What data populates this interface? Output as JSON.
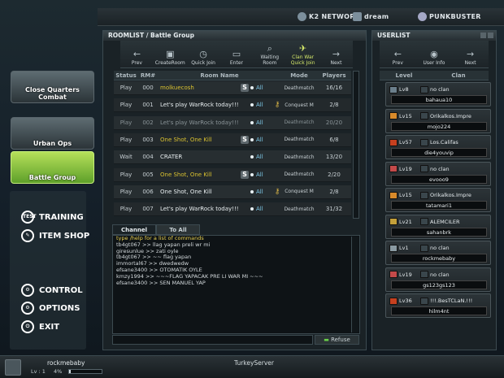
{
  "brand": {
    "left": "K2 NETWORK",
    "mid": "dream",
    "right": "PUNKBUSTER"
  },
  "roomlist": {
    "title": "ROOMLIST / Battle Group",
    "toolbar": [
      {
        "label": "Prev",
        "icon": "←"
      },
      {
        "label": "CreateRoom",
        "icon": "▣"
      },
      {
        "label": "Quick Join",
        "icon": "◷"
      },
      {
        "label": "Enter",
        "icon": "▭"
      },
      {
        "label": "Waiting Room",
        "icon": "⌕"
      },
      {
        "label": "Clan War Quick Join",
        "icon": "✈"
      },
      {
        "label": "Next",
        "icon": "→"
      }
    ],
    "headers": [
      "Status",
      "RM#",
      "Room Name",
      "Mode",
      "Players"
    ],
    "rows": [
      {
        "status": "Play",
        "rm": "000",
        "name": "molkuecosh",
        "s": true,
        "key": false,
        "mode": "Deathmatch",
        "players": "16/16",
        "color": "#d8c030"
      },
      {
        "status": "Play",
        "rm": "001",
        "name": "Let's play WarRock today!!!",
        "s": false,
        "key": true,
        "mode": "Conquest M",
        "players": "2/8",
        "color": "#e8eef0"
      },
      {
        "status": "Play",
        "rm": "002",
        "name": "Let's play WarRock today!!!",
        "s": false,
        "key": false,
        "mode": "Deathmatch",
        "players": "20/20",
        "color": "#8a9498"
      },
      {
        "status": "Play",
        "rm": "003",
        "name": "One Shot, One Kill",
        "s": true,
        "key": false,
        "mode": "Deathmatch",
        "players": "6/8",
        "color": "#d8c030"
      },
      {
        "status": "Wait",
        "rm": "004",
        "name": "CRATER",
        "s": false,
        "key": false,
        "mode": "Deathmatch",
        "players": "13/20",
        "color": "#e8eef0"
      },
      {
        "status": "Play",
        "rm": "005",
        "name": "One Shot, One Kill",
        "s": true,
        "key": false,
        "mode": "Deathmatch",
        "players": "2/20",
        "color": "#d8c030"
      },
      {
        "status": "Play",
        "rm": "006",
        "name": "One Shot, One Kill",
        "s": false,
        "key": true,
        "mode": "Conquest M",
        "players": "2/8",
        "color": "#e8eef0"
      },
      {
        "status": "Play",
        "rm": "007",
        "name": "Let's play WarRock today!!!",
        "s": false,
        "key": false,
        "mode": "Deathmatch",
        "players": "31/32",
        "color": "#e8eef0"
      }
    ],
    "all_label": "All"
  },
  "chat": {
    "tabs": [
      "Channel",
      "To All"
    ],
    "lines": [
      "type /help for a list of commands",
      "tb4gt067  >>  llag yapan preli wr mi",
      "giresunlue  >>  zati oyle",
      "tb4gt067  >>  ~~ flag yapan",
      "immortal67  >>  dwedwedw",
      "efsane3400  >>  OTOMATIK OYLE",
      "kmzy1994  >>  ~~~FLAG YAPACAK PRE LI WAR MI ~~~",
      "efsane3400  >>  SEN MANUEL YAP"
    ],
    "refuse_label": "Refuse"
  },
  "userlist": {
    "title": "USERLIST",
    "toolbar": [
      {
        "label": "Prev",
        "icon": "←"
      },
      {
        "label": "User Info",
        "icon": "◉"
      },
      {
        "label": "Next",
        "icon": "→"
      }
    ],
    "headers": [
      "Level",
      "Clan"
    ],
    "users": [
      {
        "level": "Lv8",
        "clan": "no clan",
        "nick": "bahaua10",
        "rank_color": "#6b7f8c"
      },
      {
        "level": "Lv15",
        "clan": "Orikalkos.Impre",
        "nick": "mojo224",
        "rank_color": "#d88a2a"
      },
      {
        "level": "Lv57",
        "clan": "Los.Califas",
        "nick": "die4youvip",
        "rank_color": "#c6401f"
      },
      {
        "level": "Lv19",
        "clan": "no clan",
        "nick": "evooo9",
        "rank_color": "#c44a4a"
      },
      {
        "level": "Lv15",
        "clan": "Orikalkos.Impre",
        "nick": "tatamari1",
        "rank_color": "#d88a2a"
      },
      {
        "level": "Lv21",
        "clan": "ALEMCILER",
        "nick": "sahanbrk",
        "rank_color": "#c4a03a"
      },
      {
        "level": "Lv1",
        "clan": "no clan",
        "nick": "rockmebaby",
        "rank_color": "#8a9aa2"
      },
      {
        "level": "Lv19",
        "clan": "no clan",
        "nick": "gs123gs123",
        "rank_color": "#c44a4a"
      },
      {
        "level": "Lv36",
        "clan": "!!!.BesTCLaN.!!!",
        "nick": "hilm4nt",
        "rank_color": "#c6401f"
      }
    ]
  },
  "nav": {
    "items": [
      {
        "label": "Close Quarters Combat",
        "selected": false
      },
      {
        "label": "Urban Ops",
        "selected": false
      },
      {
        "label": "Battle Group",
        "selected": true
      }
    ],
    "menu": [
      {
        "label": "TRAINING",
        "icon": "TEST"
      },
      {
        "label": "ITEM SHOP",
        "icon": "✎"
      },
      {
        "label": "CONTROL",
        "icon": "⚙"
      },
      {
        "label": "OPTIONS",
        "icon": "⚙"
      },
      {
        "label": "EXIT",
        "icon": "⏻"
      }
    ]
  },
  "status": {
    "username": "rockmebaby",
    "level": "Lv : 1",
    "exp": "4%",
    "server": "TurkeyServer"
  }
}
